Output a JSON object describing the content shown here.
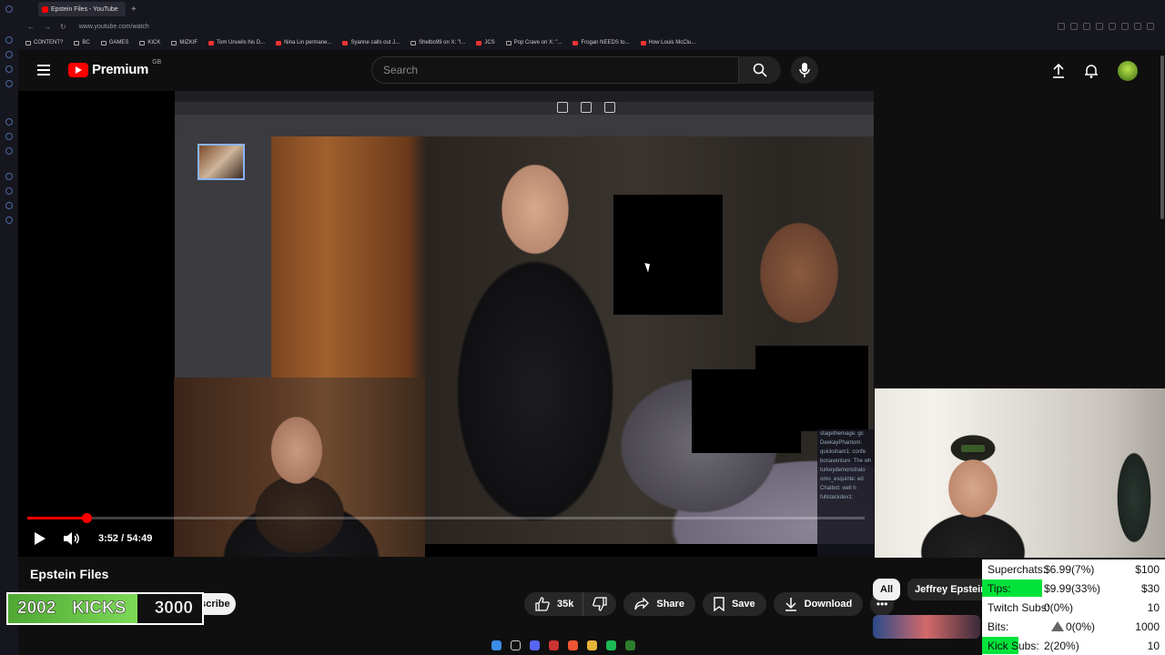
{
  "browser": {
    "tab_title": "Epstein Files - YouTube",
    "url": "www.youtube.com/watch",
    "bookmarks": [
      "CONTENT?",
      "BC",
      "GAMES",
      "KICK",
      "MIZKIF",
      "Tom Unveils his D...",
      "Nina Lin permane...",
      "Syanne calls out J...",
      "Shelbo99 on X: \"l...",
      "JCS",
      "Pop Crave on X: \"...",
      "Frogan NEEDS to...",
      "How Louis McClu..."
    ]
  },
  "masthead": {
    "logo_text": "Premium",
    "region": "GB",
    "search_placeholder": "Search",
    "icons": [
      "menu-icon",
      "search-icon",
      "mic-icon",
      "upload-icon",
      "bell-icon"
    ]
  },
  "player": {
    "current_time": "3:52",
    "separator": " / ",
    "duration": "54:49",
    "progress_fraction": 0.0706,
    "chat_lines": [
      "stagethemage: gc",
      "DeekayPhantom:",
      "quicksham1: confe",
      "bonaventure: The wh",
      "turkeydemonstrato",
      "omo_esquinte: ed",
      "Chatbot: well h",
      "fullstackdev1:"
    ]
  },
  "video": {
    "title": "Epstein Files",
    "subscribe_label": "Subscribe",
    "likes": "35k",
    "share_label": "Share",
    "save_label": "Save",
    "download_label": "Download"
  },
  "kicks_goal": {
    "current": "2002",
    "label": "KICKS",
    "goal": "3000",
    "fraction": 0.667
  },
  "chips": [
    "All",
    "Jeffrey Epstein"
  ],
  "stats": [
    {
      "label": "Superchats:",
      "value": "$6.99(7%)",
      "goal": "$100",
      "fraction": 0.0
    },
    {
      "label": "Tips:",
      "value": "$9.99(33%)",
      "goal": "$30",
      "fraction": 0.33
    },
    {
      "label": "Twitch Subs:",
      "value": "0(0%)",
      "goal": "10",
      "fraction": 0.0
    },
    {
      "label": "Bits:",
      "value": "0(0%)",
      "goal": "1000",
      "fraction": 0.0
    },
    {
      "label": "Kick Subs:",
      "value": "2(20%)",
      "goal": "10",
      "fraction": 0.2
    }
  ],
  "colors": {
    "youtube_red": "#ff0000",
    "progress_green": "#00e33a",
    "kicks_green": "#5fbf3f"
  }
}
